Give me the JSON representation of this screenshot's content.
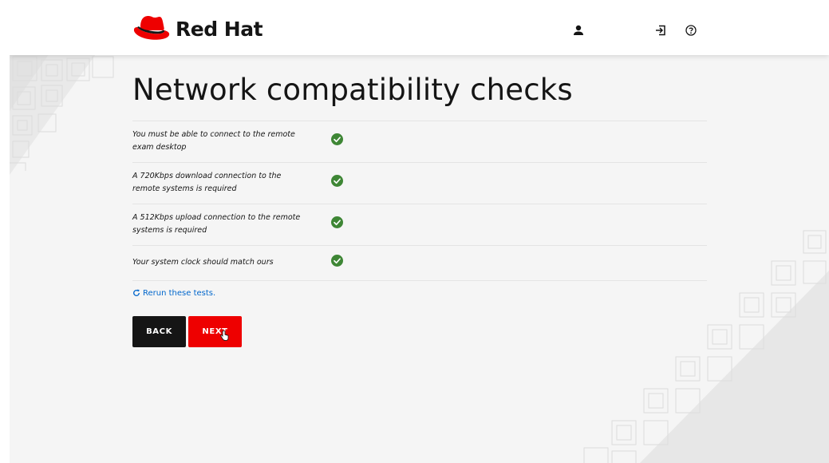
{
  "brand": {
    "name": "Red Hat",
    "color": "#ee0000"
  },
  "header": {
    "icons": [
      "user-icon",
      "logout-icon",
      "help-icon"
    ]
  },
  "page": {
    "title": "Network compatibility checks"
  },
  "checks": [
    {
      "label": "You must be able to connect to the remote exam desktop",
      "status": "passed"
    },
    {
      "label": "A 720Kbps download connection to the remote systems is required",
      "status": "passed"
    },
    {
      "label": "A 512Kbps upload connection to the remote systems is required",
      "status": "passed"
    },
    {
      "label": "Your system clock should match ours",
      "status": "passed"
    }
  ],
  "status_color": "#3e8635",
  "rerun": {
    "label": "Rerun these tests."
  },
  "buttons": {
    "back": "BACK",
    "next": "NEXT"
  }
}
